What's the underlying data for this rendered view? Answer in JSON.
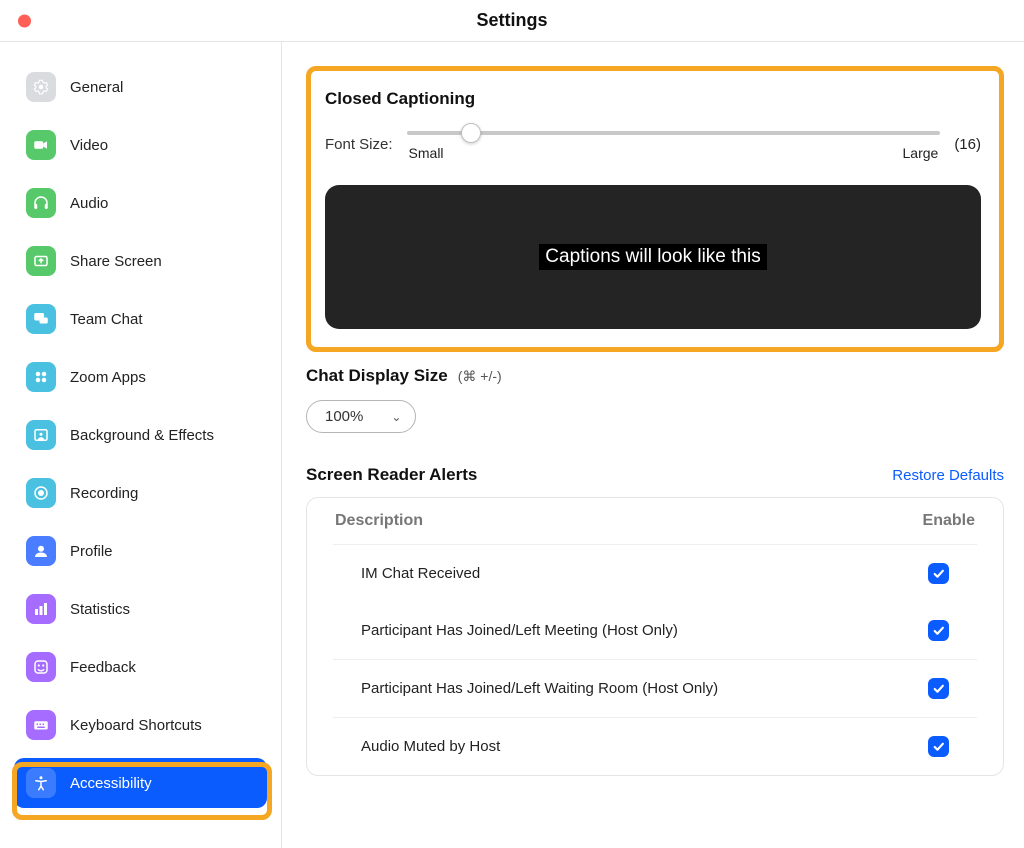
{
  "title": "Settings",
  "sidebar": {
    "items": [
      {
        "id": "general",
        "label": "General",
        "icon": "gear",
        "bg": "#d9dbde",
        "fg": "#fff"
      },
      {
        "id": "video",
        "label": "Video",
        "icon": "video",
        "bg": "#58c96b",
        "fg": "#fff"
      },
      {
        "id": "audio",
        "label": "Audio",
        "icon": "headphones",
        "bg": "#58c96b",
        "fg": "#fff"
      },
      {
        "id": "share",
        "label": "Share Screen",
        "icon": "share",
        "bg": "#58c96b",
        "fg": "#fff"
      },
      {
        "id": "chat",
        "label": "Team Chat",
        "icon": "chat",
        "bg": "#4ac1e0",
        "fg": "#fff"
      },
      {
        "id": "apps",
        "label": "Zoom Apps",
        "icon": "apps",
        "bg": "#4ac1e0",
        "fg": "#fff"
      },
      {
        "id": "bg",
        "label": "Background & Effects",
        "icon": "bg",
        "bg": "#4ac1e0",
        "fg": "#fff"
      },
      {
        "id": "recording",
        "label": "Recording",
        "icon": "rec",
        "bg": "#4ac1e0",
        "fg": "#fff"
      },
      {
        "id": "profile",
        "label": "Profile",
        "icon": "profile",
        "bg": "#4a7dff",
        "fg": "#fff"
      },
      {
        "id": "stats",
        "label": "Statistics",
        "icon": "stats",
        "bg": "#a66cff",
        "fg": "#fff"
      },
      {
        "id": "feedback",
        "label": "Feedback",
        "icon": "feedback",
        "bg": "#a66cff",
        "fg": "#fff"
      },
      {
        "id": "keyboard",
        "label": "Keyboard Shortcuts",
        "icon": "keyboard",
        "bg": "#a66cff",
        "fg": "#fff"
      },
      {
        "id": "accessibility",
        "label": "Accessibility",
        "icon": "accessibility",
        "bg": "#0b5cff",
        "fg": "#fff",
        "active": true
      }
    ]
  },
  "cc": {
    "title": "Closed Captioning",
    "font_label": "Font Size:",
    "small_label": "Small",
    "large_label": "Large",
    "value_display": "(16)",
    "preview_text": "Captions will look like this"
  },
  "chat": {
    "title": "Chat Display Size",
    "shortcut": "(⌘ +/-)",
    "value": "100%"
  },
  "sr": {
    "title": "Screen Reader Alerts",
    "restore": "Restore Defaults",
    "col_desc": "Description",
    "col_enable": "Enable",
    "rows": [
      {
        "label": "IM Chat Received",
        "enabled": true
      },
      {
        "label": "Participant Has Joined/Left Meeting (Host Only)",
        "enabled": true
      },
      {
        "label": "Participant Has Joined/Left Waiting Room (Host Only)",
        "enabled": true
      },
      {
        "label": "Audio Muted by Host",
        "enabled": true
      }
    ]
  }
}
